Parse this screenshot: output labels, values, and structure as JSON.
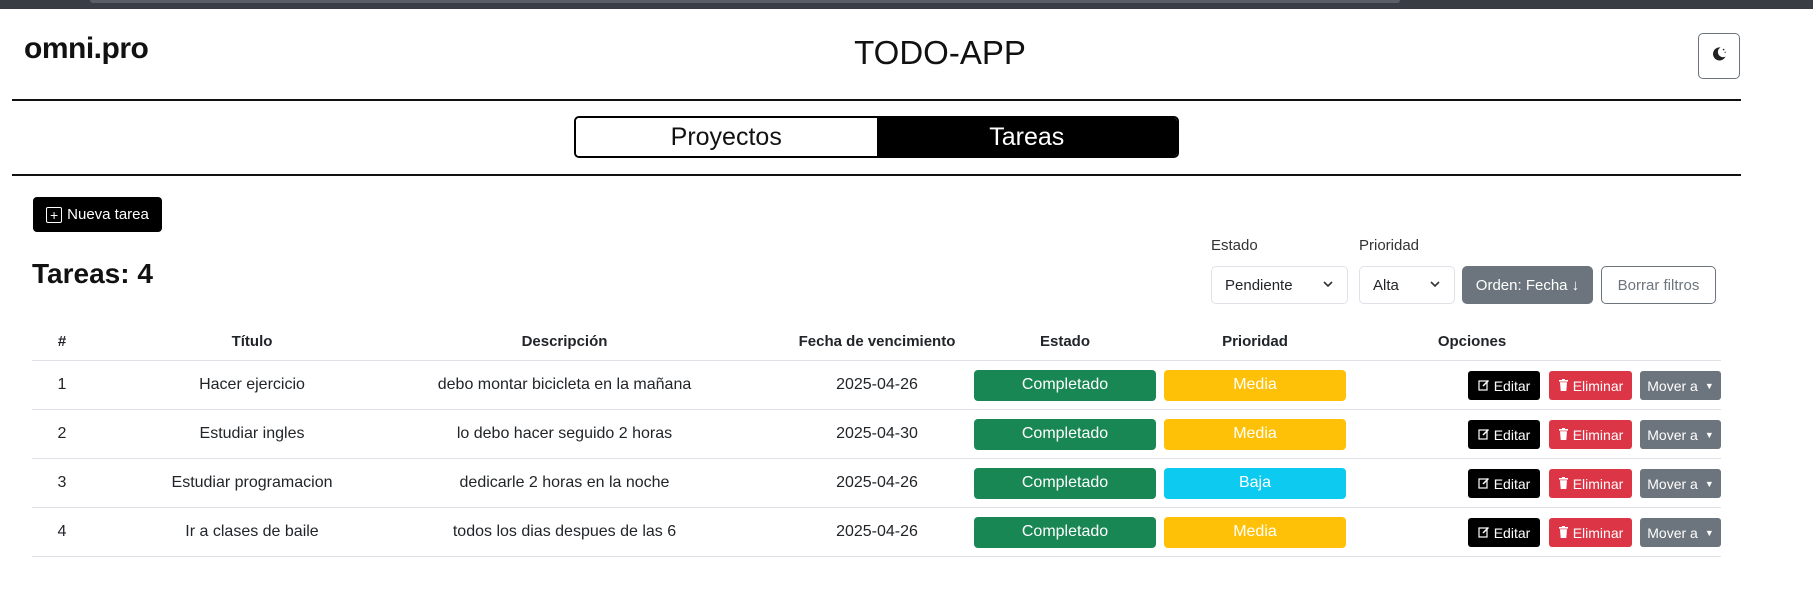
{
  "header": {
    "logo": "omni.pro",
    "title": "TODO-APP",
    "theme_toggle_icon": "moon-icon"
  },
  "segmented": {
    "projects_label": "Proyectos",
    "tasks_label": "Tareas",
    "active": "Tareas"
  },
  "toolbar": {
    "new_task_label": "Nueva tarea",
    "count_title": "Tareas: 4"
  },
  "filters": {
    "estado_label": "Estado",
    "estado_value": "Pendiente",
    "prioridad_label": "Prioridad",
    "prioridad_value": "Alta",
    "sort_label": "Orden: Fecha ↓",
    "clear_label": "Borrar filtros"
  },
  "table": {
    "headers": {
      "num": "#",
      "title": "Título",
      "description": "Descripción",
      "due_date": "Fecha de vencimiento",
      "status": "Estado",
      "priority": "Prioridad",
      "options": "Opciones"
    },
    "rows": [
      {
        "num": "1",
        "title": "Hacer ejercicio",
        "description": "debo montar bicicleta en la mañana",
        "due_date": "2025-04-26",
        "status": "Completado",
        "priority": "Media"
      },
      {
        "num": "2",
        "title": "Estudiar ingles",
        "description": "lo debo hacer seguido 2 horas",
        "due_date": "2025-04-30",
        "status": "Completado",
        "priority": "Media"
      },
      {
        "num": "3",
        "title": "Estudiar programacion",
        "description": "dedicarle 2 horas en la noche",
        "due_date": "2025-04-26",
        "status": "Completado",
        "priority": "Baja"
      },
      {
        "num": "4",
        "title": "Ir a clases de baile",
        "description": "todos los dias despues de las 6",
        "due_date": "2025-04-26",
        "status": "Completado",
        "priority": "Media"
      }
    ],
    "actions": {
      "edit": "Editar",
      "delete": "Eliminar",
      "move": "Mover a"
    }
  },
  "colors": {
    "status_completado": "#198754",
    "priority_media": "#ffc107",
    "priority_baja": "#0dcaf0",
    "danger": "#dc3545",
    "secondary": "#6c757d"
  }
}
